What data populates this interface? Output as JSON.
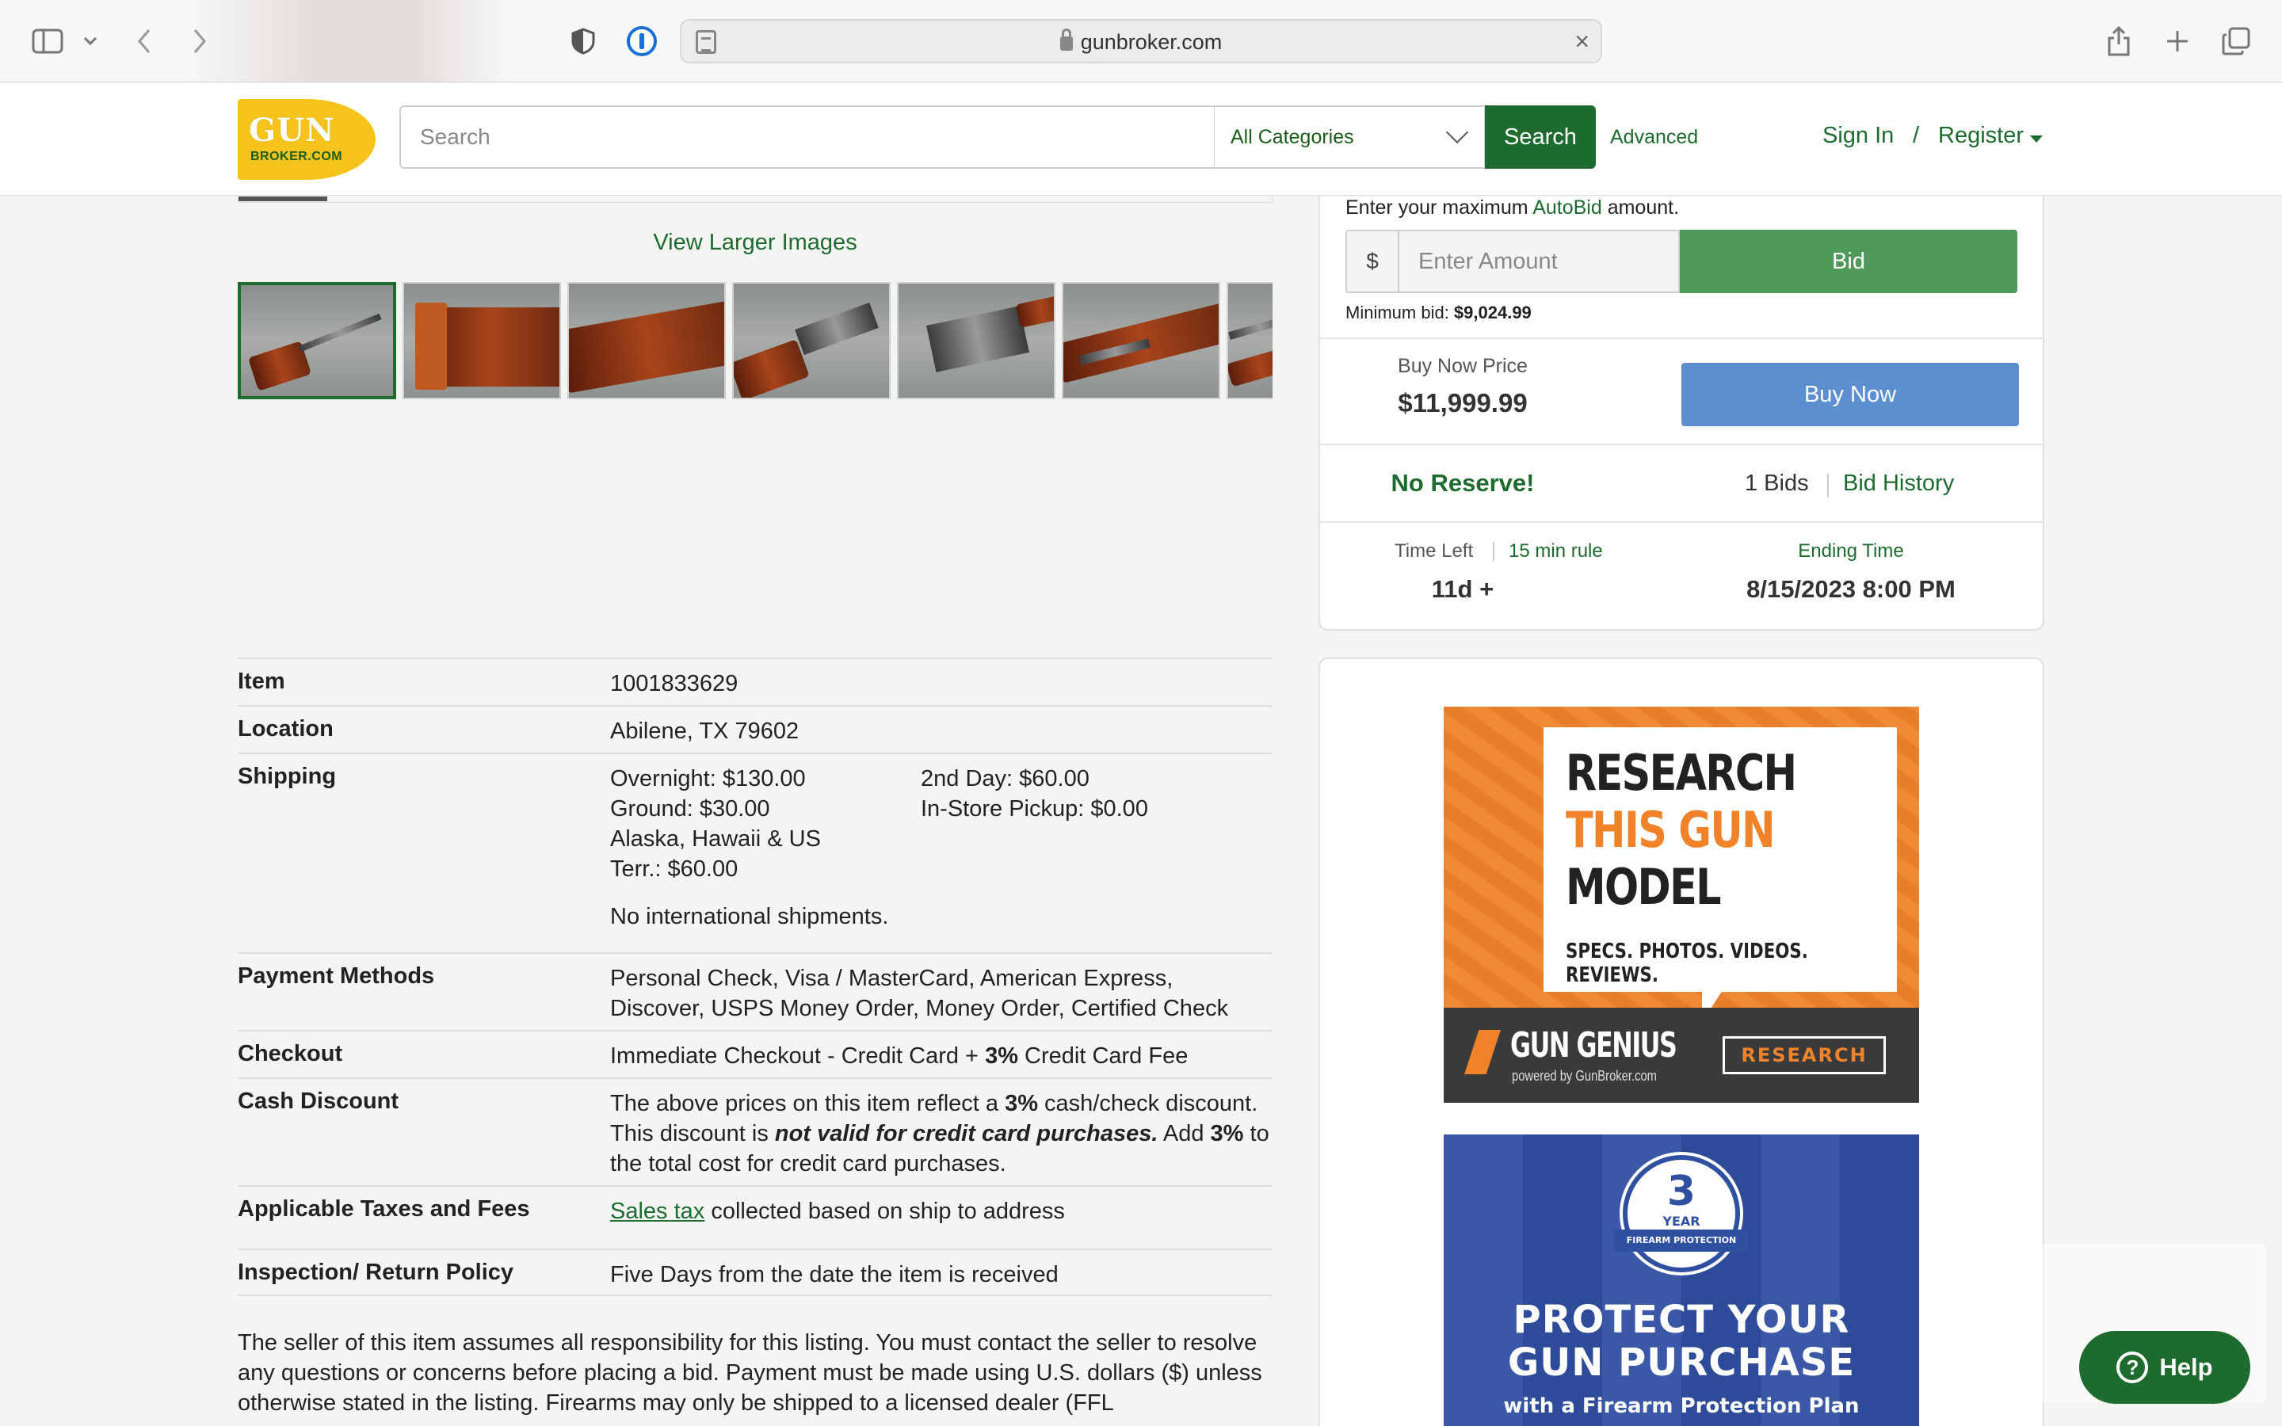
{
  "browser": {
    "url": "gunbroker.com"
  },
  "header": {
    "logo_line1": "GUN",
    "logo_line2": "BROKER.COM",
    "search_placeholder": "Search",
    "category": "All Categories",
    "search_button": "Search",
    "advanced": "Advanced",
    "sign_in": "Sign In",
    "separator": "/",
    "register": "Register"
  },
  "gallery": {
    "view_larger": "View Larger Images",
    "thumbnail_count": 7,
    "active_index": 0
  },
  "details": [
    {
      "label": "Item",
      "value": "1001833629"
    },
    {
      "label": "Location",
      "value": "Abilene, TX 79602"
    },
    {
      "label": "Shipping"
    },
    {
      "label": "Payment Methods",
      "value": "Personal Check, Visa / MasterCard, American Express, Discover, USPS Money Order, Money Order, Certified Check"
    },
    {
      "label": "Checkout"
    },
    {
      "label": "Cash Discount"
    },
    {
      "label": "Applicable Taxes and Fees"
    },
    {
      "label": "Inspection/ Return Policy",
      "value": "Five Days from the date the item is received"
    }
  ],
  "shipping": {
    "overnight": "Overnight: $130.00",
    "ground": "Ground: $30.00",
    "alaska": "Alaska, Hawaii & US",
    "terr": "Terr.: $60.00",
    "second_day": "2nd Day: $60.00",
    "in_store": "In-Store Pickup: $0.00",
    "international": "No international shipments."
  },
  "checkout": {
    "pre": "Immediate Checkout - Credit Card + ",
    "pct": "3%",
    "post": " Credit Card Fee"
  },
  "cash_discount": {
    "p1": "The above prices on this item reflect a ",
    "pct1": "3%",
    "p2": " cash/check discount. This discount is ",
    "emph": "not valid for credit card purchases.",
    "p3": " Add ",
    "pct2": "3%",
    "p4": " to the total cost for credit card purchases."
  },
  "taxes": {
    "link": "Sales tax",
    "rest": " collected based on ship to address"
  },
  "disclaimer": "The seller of this item assumes all responsibility for this listing. You must contact the seller to resolve any questions or concerns before placing a bid. Payment must be made using U.S. dollars ($) unless otherwise stated in the listing. Firearms may only be shipped to a licensed dealer (FFL",
  "bid": {
    "autobid_pre": "Enter your maximum ",
    "autobid_link": "AutoBid",
    "autobid_post": " amount.",
    "currency": "$",
    "amount_placeholder": "Enter Amount",
    "bid_button": "Bid",
    "min_bid_label": "Minimum bid: ",
    "min_bid_value": "$9,024.99",
    "buy_now_label": "Buy Now Price",
    "buy_now_price": "$11,999.99",
    "buy_now_button": "Buy Now",
    "no_reserve": "No Reserve!",
    "bids_count": "1 Bids",
    "bid_history": "Bid History",
    "time_left_label": "Time Left",
    "min_rule": "15 min rule",
    "time_left_value": "11d +",
    "ending_label": "Ending Time",
    "ending_value": "8/15/2023 8:00 PM"
  },
  "ads": {
    "research": {
      "line1": "RESEARCH",
      "line2": "THIS GUN",
      "line3": "MODEL",
      "tagline": "SPECS. PHOTOS. VIDEOS. REVIEWS.",
      "brand": "GUN GENIUS",
      "brand_sub": "powered by GunBroker.com",
      "button": "RESEARCH"
    },
    "protect": {
      "badge_num": "3",
      "badge_year": "YEAR",
      "badge_ribbon": "FIREARM PROTECTION PLAN",
      "line1": "PROTECT YOUR",
      "line2": "GUN PURCHASE",
      "line3": "with a Firearm Protection Plan"
    }
  },
  "help": {
    "label": "Help"
  },
  "colors": {
    "brand_green": "#1d6b2e",
    "bid_green": "#4f9a5b",
    "buy_now_blue": "#5b8fcf",
    "logo_yellow": "#f6c21c"
  }
}
